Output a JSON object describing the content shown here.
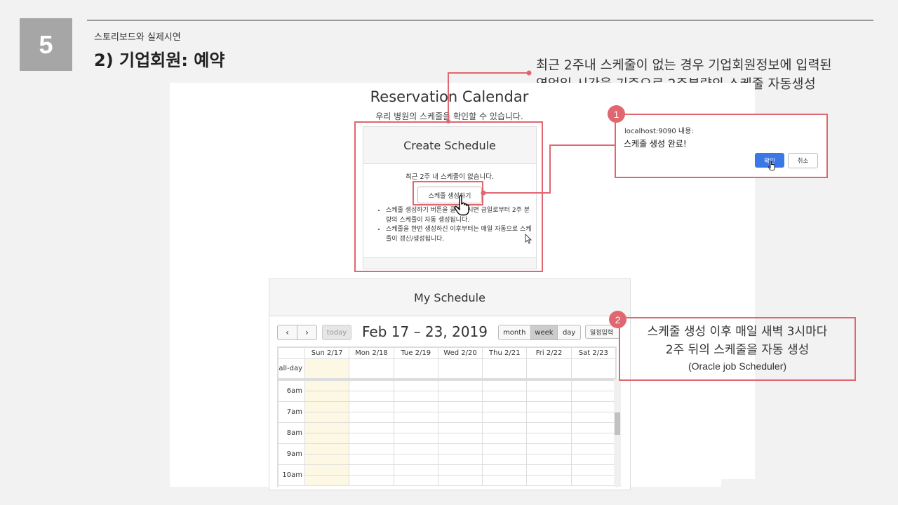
{
  "slide": {
    "number": "5",
    "subtitle": "스토리보드와 실제시연",
    "title": "2) 기업회원: 예약",
    "note_top_line1": "최근 2주내 스케줄이 없는 경우 기업회원정보에 입력된",
    "note_top_line2": "영업일,시간을 기준으로 2주분량의 스케줄 자동생성",
    "accent_color": "#e06670"
  },
  "page": {
    "title": "Reservation Calendar",
    "subtitle": "우리 병원의 스케줄을 확인할 수 있습니다."
  },
  "create_schedule": {
    "heading": "Create Schedule",
    "message": "최근 2주 내 스케줄이 없습니다.",
    "button_label": "스케줄 생성하기",
    "bullets": [
      "스케줄 생성하기 버튼을 클릭하시면 금일로부터 2주 분량의 스케줄이 자동 생성됩니다.",
      "스케줄을 한번 생성하신 이후부터는 매일 자동으로 스케줄이 갱신/생성됩니다."
    ]
  },
  "dialog": {
    "badge": "1",
    "host": "localhost:9090 내용:",
    "message": "스케줄 생성 완료!",
    "ok_label": "확인",
    "cancel_label": "취소",
    "ok_color": "#3b78e7"
  },
  "my_schedule": {
    "heading": "My Schedule",
    "prev_icon": "‹",
    "next_icon": "›",
    "today_label": "today",
    "range_title": "Feb 17 – 23, 2019",
    "views": [
      "month",
      "week",
      "day"
    ],
    "active_view": "week",
    "extra_button": "일정입력",
    "days": [
      "Sun 2/17",
      "Mon 2/18",
      "Tue 2/19",
      "Wed 2/20",
      "Thu 2/21",
      "Fri 2/22",
      "Sat 2/23"
    ],
    "all_day_label": "all-day",
    "hours": [
      "6am",
      "7am",
      "8am",
      "9am",
      "10am"
    ],
    "today_highlight": "#fcf8e3"
  },
  "note2": {
    "badge": "2",
    "line1": "스케줄 생성 이후 매일 새벽 3시마다",
    "line2": "2주 뒤의 스케줄을 자동 생성",
    "line3": "(Oracle job Scheduler)"
  }
}
